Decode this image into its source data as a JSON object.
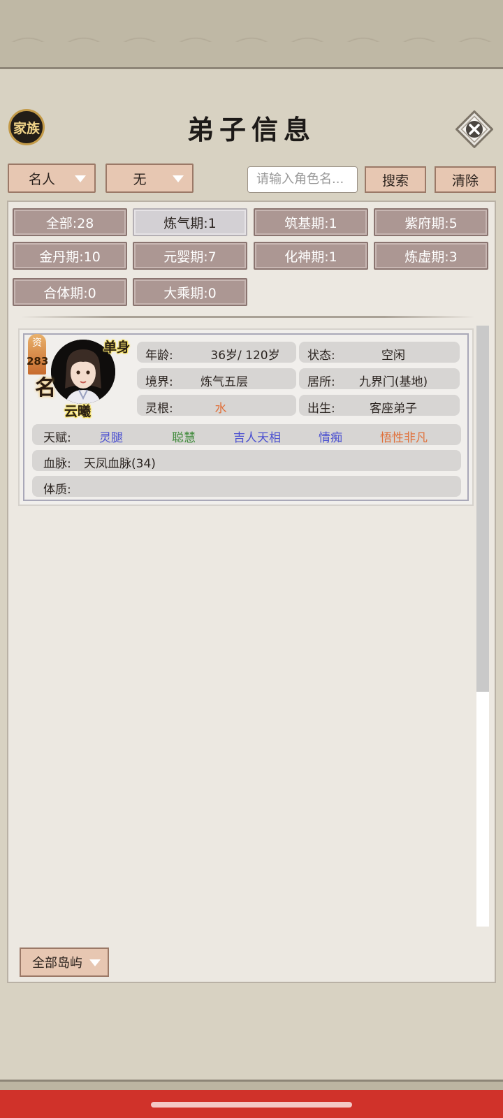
{
  "header": {
    "title": "弟子信息",
    "family_button": "家族"
  },
  "filters_top": {
    "category_dropdown": "名人",
    "secondary_dropdown": "无",
    "search_placeholder": "请输入角色名...",
    "search_button": "搜索",
    "clear_button": "清除"
  },
  "realm_filters": [
    {
      "label": "全部:28",
      "active": false
    },
    {
      "label": "炼气期:1",
      "active": true
    },
    {
      "label": "筑基期:1",
      "active": false
    },
    {
      "label": "紫府期:5",
      "active": false
    },
    {
      "label": "金丹期:10",
      "active": false
    },
    {
      "label": "元婴期:7",
      "active": false
    },
    {
      "label": "化神期:1",
      "active": false
    },
    {
      "label": "炼虚期:3",
      "active": false
    },
    {
      "label": "合体期:0",
      "active": false
    },
    {
      "label": "大乘期:0",
      "active": false
    }
  ],
  "disciple": {
    "aptitude_label": "资",
    "aptitude_value": "283",
    "fame_mark": "名",
    "marital_status": "单身",
    "name": "云曦",
    "age_label": "年龄:",
    "age_value": "36岁/ 120岁",
    "status_label": "状态:",
    "status_value": "空闲",
    "realm_label": "境界:",
    "realm_value": "炼气五层",
    "residence_label": "居所:",
    "residence_value": "九界门(基地)",
    "root_label": "灵根:",
    "root_value": "水",
    "birth_label": "出生:",
    "birth_value": "客座弟子",
    "talent_label": "天赋:",
    "talents": [
      {
        "text": "灵腿",
        "color": "#4a4fd0"
      },
      {
        "text": "聪慧",
        "color": "#3f8a3a"
      },
      {
        "text": "吉人天相",
        "color": "#4a4fd0"
      },
      {
        "text": "情痴",
        "color": "#4a4fd0"
      },
      {
        "text": "悟性非凡",
        "color": "#e0703a"
      }
    ],
    "bloodline_label": "血脉:",
    "bloodline_value": "天凤血脉(34)",
    "physique_label": "体质:",
    "physique_value": ""
  },
  "footer": {
    "island_dropdown": "全部岛屿"
  },
  "colors": {
    "accent_button": "#e7c7b2",
    "filter_button": "#ac9793",
    "root_water": "#e0703a"
  }
}
